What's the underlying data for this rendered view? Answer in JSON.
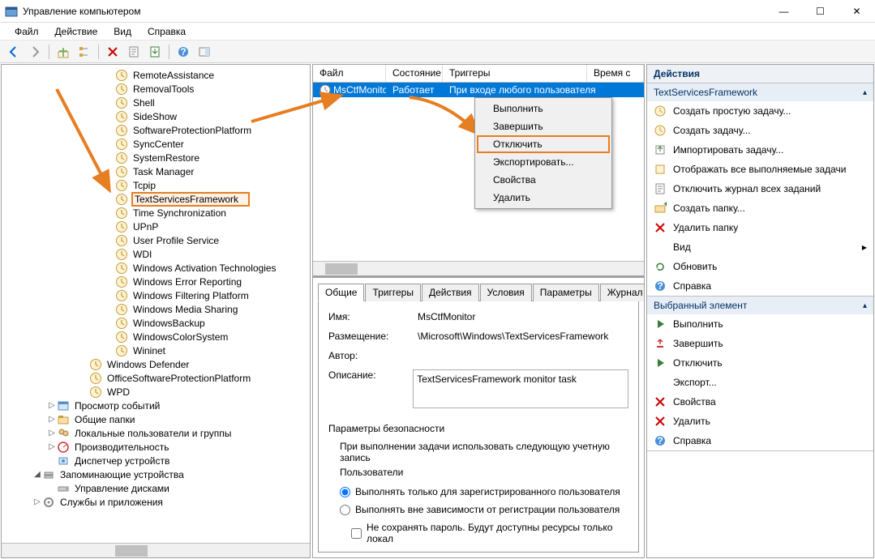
{
  "window": {
    "title": "Управление компьютером",
    "min": "—",
    "max": "☐",
    "close": "✕"
  },
  "menu": [
    "Файл",
    "Действие",
    "Вид",
    "Справка"
  ],
  "tree": {
    "items": [
      {
        "label": "RemoteAssistance",
        "lev": 5,
        "icon": "folder"
      },
      {
        "label": "RemovalTools",
        "lev": 5,
        "icon": "folder"
      },
      {
        "label": "Shell",
        "lev": 5,
        "icon": "folder"
      },
      {
        "label": "SideShow",
        "lev": 5,
        "icon": "folder"
      },
      {
        "label": "SoftwareProtectionPlatform",
        "lev": 5,
        "icon": "folder"
      },
      {
        "label": "SyncCenter",
        "lev": 5,
        "icon": "folder"
      },
      {
        "label": "SystemRestore",
        "lev": 5,
        "icon": "folder"
      },
      {
        "label": "Task Manager",
        "lev": 5,
        "icon": "folder"
      },
      {
        "label": "Tcpip",
        "lev": 5,
        "icon": "folder"
      },
      {
        "label": "TextServicesFramework",
        "lev": 5,
        "icon": "folder",
        "hl": true
      },
      {
        "label": "Time Synchronization",
        "lev": 5,
        "icon": "folder"
      },
      {
        "label": "UPnP",
        "lev": 5,
        "icon": "folder"
      },
      {
        "label": "User Profile Service",
        "lev": 5,
        "icon": "folder"
      },
      {
        "label": "WDI",
        "lev": 5,
        "icon": "folder"
      },
      {
        "label": "Windows Activation Technologies",
        "lev": 5,
        "icon": "folder"
      },
      {
        "label": "Windows Error Reporting",
        "lev": 5,
        "icon": "folder"
      },
      {
        "label": "Windows Filtering Platform",
        "lev": 5,
        "icon": "folder"
      },
      {
        "label": "Windows Media Sharing",
        "lev": 5,
        "icon": "folder"
      },
      {
        "label": "WindowsBackup",
        "lev": 5,
        "icon": "folder"
      },
      {
        "label": "WindowsColorSystem",
        "lev": 5,
        "icon": "folder"
      },
      {
        "label": "Wininet",
        "lev": 5,
        "icon": "folder"
      },
      {
        "label": "Windows Defender",
        "lev": 4,
        "icon": "folder"
      },
      {
        "label": "OfficeSoftwareProtectionPlatform",
        "lev": 4,
        "icon": "folder"
      },
      {
        "label": "WPD",
        "lev": 4,
        "icon": "folder"
      },
      {
        "label": "Просмотр событий",
        "lev": 2,
        "icon": "eventviewer",
        "exp": "▷"
      },
      {
        "label": "Общие папки",
        "lev": 2,
        "icon": "shared",
        "exp": "▷"
      },
      {
        "label": "Локальные пользователи и группы",
        "lev": 2,
        "icon": "users",
        "exp": "▷"
      },
      {
        "label": "Производительность",
        "lev": 2,
        "icon": "perf",
        "exp": "▷"
      },
      {
        "label": "Диспетчер устройств",
        "lev": 2,
        "icon": "devmgr"
      },
      {
        "label": "Запоминающие устройства",
        "lev": 1,
        "icon": "storage",
        "exp": "◢"
      },
      {
        "label": "Управление дисками",
        "lev": 2,
        "icon": "diskmgr"
      },
      {
        "label": "Службы и приложения",
        "lev": 1,
        "icon": "services",
        "exp": "▷"
      }
    ]
  },
  "task_header": {
    "c1": "Файл",
    "c2": "Состояние",
    "c3": "Триггеры",
    "c4": "Время с"
  },
  "task_row": {
    "name": "MsCtfMonitor",
    "state": "Работает",
    "trigger": "При входе любого пользователя"
  },
  "context": [
    "Выполнить",
    "Завершить",
    "Отключить",
    "Экспортировать...",
    "Свойства",
    "Удалить"
  ],
  "tabs": [
    "Общие",
    "Триггеры",
    "Действия",
    "Условия",
    "Параметры",
    "Журнал"
  ],
  "props": {
    "name_lbl": "Имя:",
    "name_val": "MsCtfMonitor",
    "loc_lbl": "Размещение:",
    "loc_val": "\\Microsoft\\Windows\\TextServicesFramework",
    "author_lbl": "Автор:",
    "author_val": "",
    "desc_lbl": "Описание:",
    "desc_val": "TextServicesFramework monitor task",
    "sec_legend": "Параметры безопасности",
    "sec_account": "При выполнении задачи использовать следующую учетную запись",
    "sec_users": "Пользователи",
    "r1": "Выполнять только для зарегистрированного пользователя",
    "r2": "Выполнять вне зависимости от регистрации пользователя",
    "cb": "Не сохранять пароль. Будут доступны ресурсы только локал"
  },
  "actions": {
    "title": "Действия",
    "section1": "TextServicesFramework",
    "group1": [
      {
        "label": "Создать простую задачу...",
        "icon": "task-new"
      },
      {
        "label": "Создать задачу...",
        "icon": "task-new"
      },
      {
        "label": "Импортировать задачу...",
        "icon": "import"
      },
      {
        "label": "Отображать все выполняемые задачи",
        "icon": "run"
      },
      {
        "label": "Отключить журнал всех заданий",
        "icon": "log"
      },
      {
        "label": "Создать папку...",
        "icon": "folder-new"
      },
      {
        "label": "Удалить папку",
        "icon": "delete-x"
      },
      {
        "label": "Вид",
        "icon": "",
        "sub": true
      },
      {
        "label": "Обновить",
        "icon": "refresh"
      },
      {
        "label": "Справка",
        "icon": "help"
      }
    ],
    "section2": "Выбранный элемент",
    "group2": [
      {
        "label": "Выполнить",
        "icon": "play"
      },
      {
        "label": "Завершить",
        "icon": "stop"
      },
      {
        "label": "Отключить",
        "icon": "disable"
      },
      {
        "label": "Экспорт...",
        "icon": ""
      },
      {
        "label": "Свойства",
        "icon": "delete-x"
      },
      {
        "label": "Удалить",
        "icon": "delete-x"
      },
      {
        "label": "Справка",
        "icon": "help"
      }
    ]
  }
}
